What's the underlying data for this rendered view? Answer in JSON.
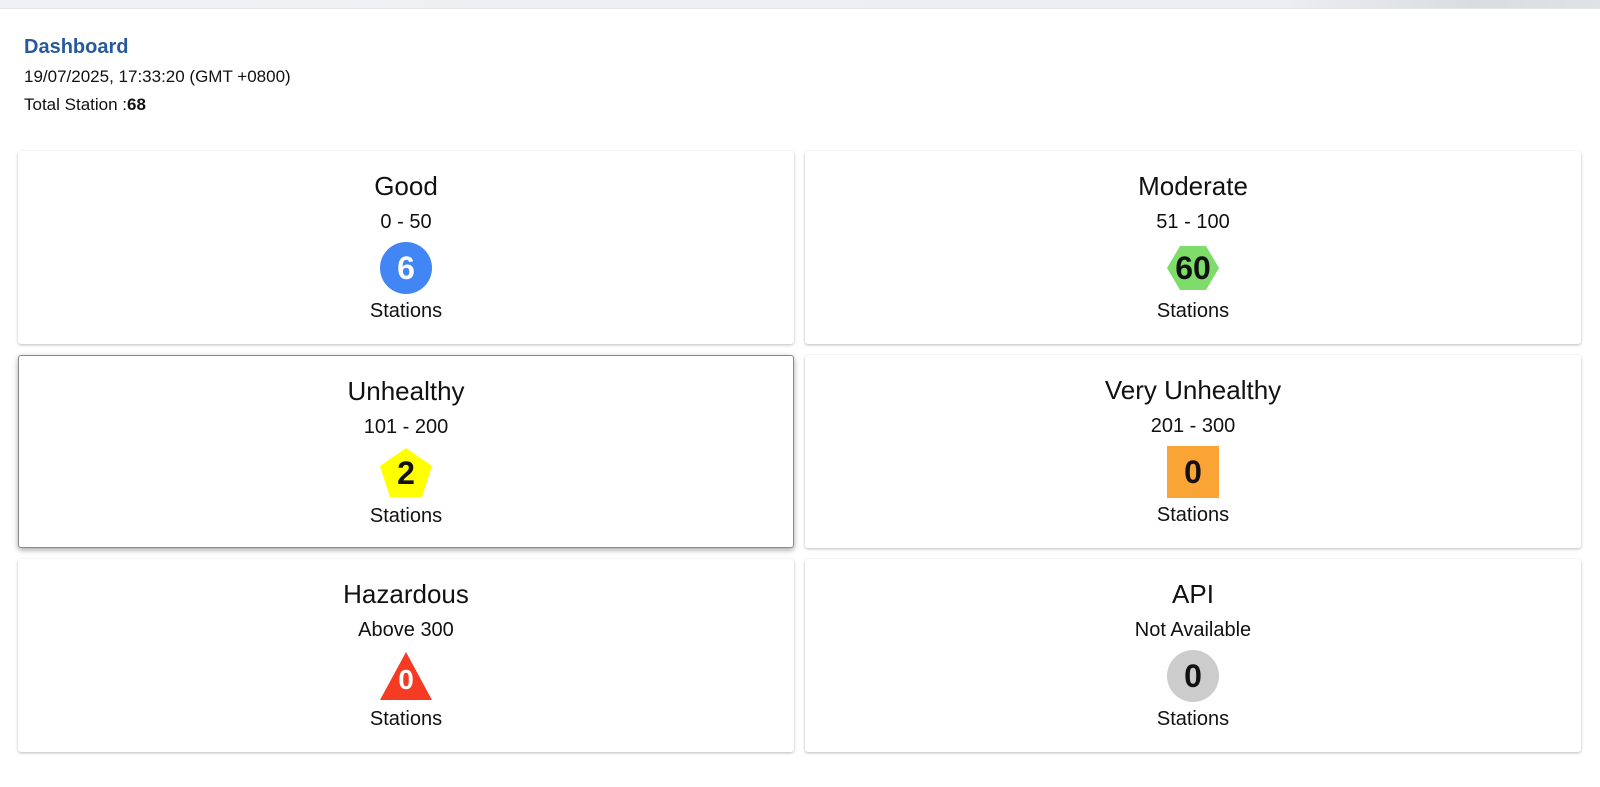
{
  "header": {
    "title": "Dashboard",
    "datetime": "19/07/2025, 17:33:20 (GMT +0800)",
    "total_label": "Total Station :",
    "total_value": "68"
  },
  "cards": [
    {
      "title": "Good",
      "range": "0 - 50",
      "count": "6",
      "subtitle": "Stations",
      "shape": "circle",
      "color": "#4285f4",
      "text_color": "#ffffff"
    },
    {
      "title": "Moderate",
      "range": "51 - 100",
      "count": "60",
      "subtitle": "Stations",
      "shape": "hexagon",
      "color": "#7ddc6a",
      "text_color": "#111111"
    },
    {
      "title": "Unhealthy",
      "range": "101 - 200",
      "count": "2",
      "subtitle": "Stations",
      "shape": "pentagon",
      "color": "#ffff00",
      "text_color": "#111111"
    },
    {
      "title": "Very Unhealthy",
      "range": "201 - 300",
      "count": "0",
      "subtitle": "Stations",
      "shape": "square",
      "color": "#f9a435",
      "text_color": "#111111"
    },
    {
      "title": "Hazardous",
      "range": "Above 300",
      "count": "0",
      "subtitle": "Stations",
      "shape": "triangle",
      "color": "#f53b23",
      "text_color": "#ffffff"
    },
    {
      "title": "API",
      "range": "Not Available",
      "count": "0",
      "subtitle": "Stations",
      "shape": "circle",
      "color": "#cccccc",
      "text_color": "#111111"
    }
  ]
}
